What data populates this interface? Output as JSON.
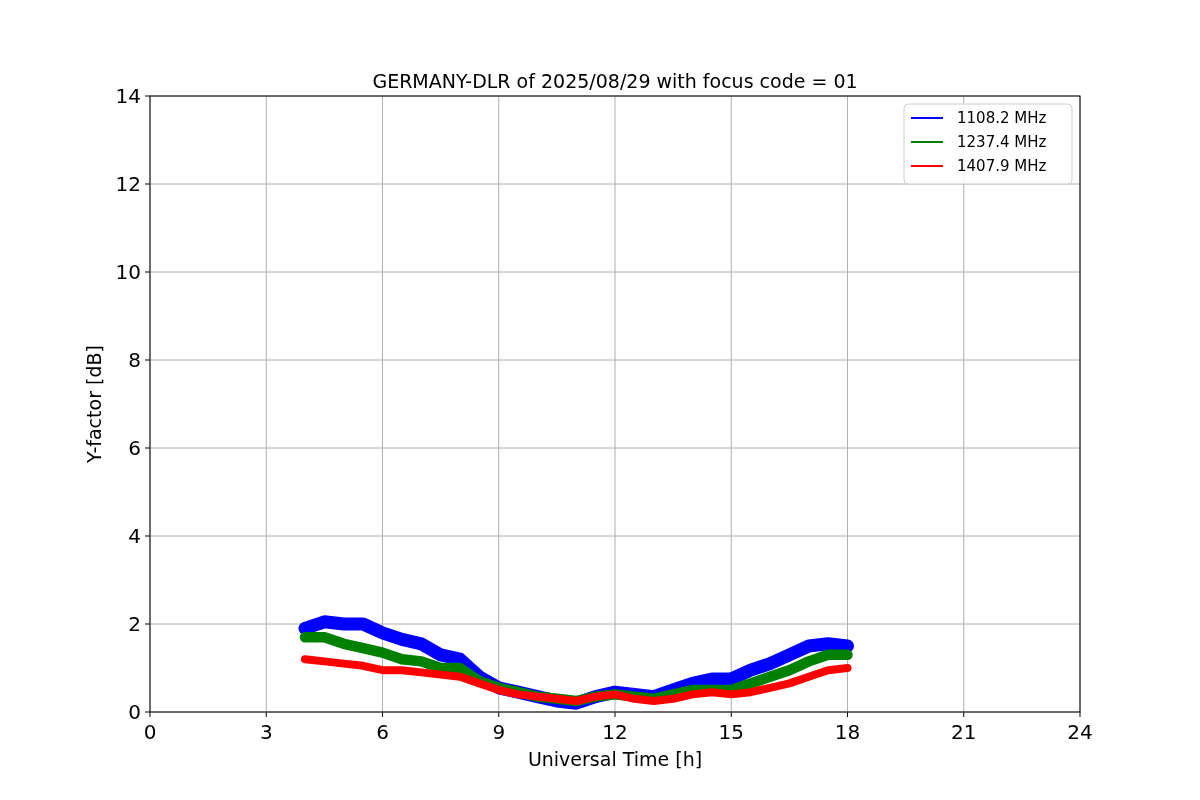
{
  "chart": {
    "chart_data": {
      "type": "line",
      "title": "GERMANY-DLR of 2025/08/29 with focus code = 01",
      "xlabel": "Universal Time [h]",
      "ylabel": "Y-factor [dB]",
      "x": [
        4,
        4.5,
        5,
        5.5,
        6,
        6.5,
        7,
        7.5,
        8,
        8.5,
        9,
        9.5,
        10,
        10.5,
        11,
        11.5,
        12,
        12.5,
        13,
        13.5,
        14,
        14.5,
        15,
        15.5,
        16,
        16.5,
        17,
        17.5,
        18
      ],
      "series": [
        {
          "name": "1108.2 MHz",
          "color": "#0000ff",
          "values": [
            1.9,
            2.05,
            2.0,
            2.0,
            1.8,
            1.65,
            1.55,
            1.3,
            1.2,
            0.8,
            0.55,
            0.45,
            0.35,
            0.25,
            0.2,
            0.35,
            0.45,
            0.4,
            0.35,
            0.5,
            0.65,
            0.75,
            0.75,
            0.95,
            1.1,
            1.3,
            1.5,
            1.55,
            1.5
          ]
        },
        {
          "name": "1237.4 MHz",
          "color": "#008000",
          "values": [
            1.7,
            1.7,
            1.55,
            1.45,
            1.35,
            1.2,
            1.15,
            1.0,
            1.0,
            0.7,
            0.55,
            0.45,
            0.35,
            0.3,
            0.25,
            0.35,
            0.4,
            0.35,
            0.3,
            0.4,
            0.5,
            0.5,
            0.5,
            0.65,
            0.8,
            0.95,
            1.15,
            1.3,
            1.3
          ]
        },
        {
          "name": "1407.9 MHz",
          "color": "#ff0000",
          "values": [
            1.2,
            1.15,
            1.1,
            1.05,
            0.95,
            0.95,
            0.9,
            0.85,
            0.8,
            0.65,
            0.5,
            0.4,
            0.35,
            0.3,
            0.25,
            0.35,
            0.4,
            0.3,
            0.25,
            0.3,
            0.4,
            0.45,
            0.4,
            0.45,
            0.55,
            0.65,
            0.8,
            0.95,
            1.0
          ]
        }
      ],
      "xlim": [
        0,
        24
      ],
      "ylim": [
        0,
        14
      ],
      "xticks": [
        0,
        3,
        6,
        9,
        12,
        15,
        18,
        21,
        24
      ],
      "yticks": [
        0,
        2,
        4,
        6,
        8,
        10,
        12,
        14
      ],
      "grid": true,
      "legend": true
    }
  }
}
